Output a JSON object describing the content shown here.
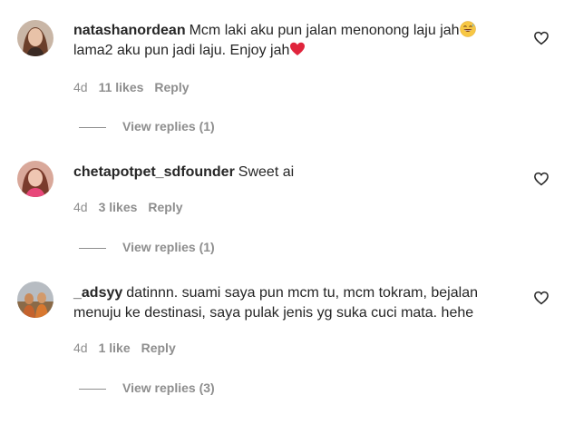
{
  "comments": [
    {
      "username": "natashanordean",
      "text_line1": "Mcm laki aku pun jalan menonong laju jah",
      "emoji1": "grinning-sweat-emoji",
      "text_line2": "lama2 aku pun jadi laju. Enjoy jah",
      "emoji2": "red-heart-emoji",
      "time": "4d",
      "likes": "11 likes",
      "reply": "Reply",
      "view_replies": "View replies (1)"
    },
    {
      "username": "chetapotpet_sdfounder",
      "text": "Sweet ai",
      "time": "4d",
      "likes": "3 likes",
      "reply": "Reply",
      "view_replies": "View replies (1)"
    },
    {
      "username": "_adsyy",
      "text": "datinnn. suami saya pun mcm tu, mcm tokram, bejalan menuju ke destinasi, saya pulak jenis yg suka cuci mata. hehe",
      "time": "4d",
      "likes": "1 like",
      "reply": "Reply",
      "view_replies": "View replies (3)"
    }
  ],
  "colors": {
    "text": "#262626",
    "secondary": "#8e8e8e",
    "heart_red": "#e0245e"
  },
  "icons": {
    "like": "heart-outline-icon"
  }
}
